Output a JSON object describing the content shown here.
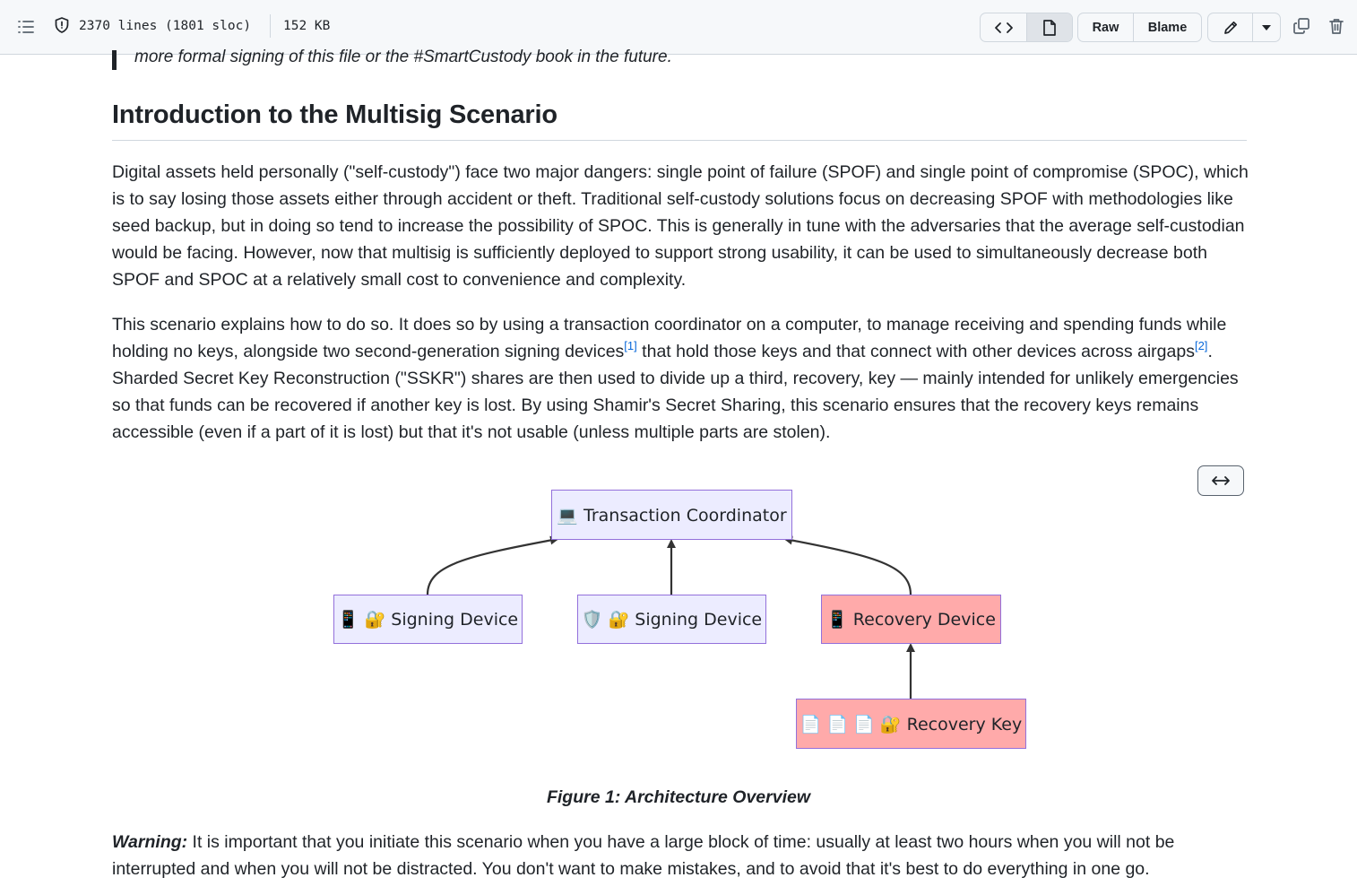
{
  "toolbar": {
    "lines_info": "2370 lines (1801 sloc)",
    "file_size": "152 KB",
    "raw_label": "Raw",
    "blame_label": "Blame"
  },
  "article": {
    "quote_text": "more formal signing of this file or the #SmartCustody book in the future.",
    "heading": "Introduction to the Multisig Scenario",
    "p1": "Digital assets held personally (\"self-custody\") face two major dangers: single point of failure (SPOF) and single point of compromise (SPOC), which is to say losing those assets either through accident or theft. Traditional self-custody solutions focus on decreasing SPOF with methodologies like seed backup, but in doing so tend to increase the possibility of SPOC. This is generally in tune with the adversaries that the average self-custodian would be facing. However, now that multisig is sufficiently deployed to support strong usability, it can be used to simultaneously decrease both SPOF and SPOC at a relatively small cost to convenience and complexity.",
    "p2_a": "This scenario explains how to do so. It does so by using a transaction coordinator on a computer, to manage receiving and spending funds while holding no keys, alongside two second-generation signing devices",
    "p2_fn1": "[1]",
    "p2_b": " that hold those keys and that connect with other devices across airgaps",
    "p2_fn2": "[2]",
    "p2_c": ". Sharded Secret Key Reconstruction (\"SSKR\") shares are then used to divide up a third, recovery, key — mainly intended for unlikely emergencies so that funds can be recovered if another key is lost. By using Shamir's Secret Sharing, this scenario ensures that the recovery keys remains accessible (even if a part of it is lost) but that it's not usable (unless multiple parts are stolen).",
    "warning_label": "Warning:",
    "warning_text": " It is important that you initiate this scenario when you have a large block of time: usually at least two hours when you will not be interrupted and when you will not be distracted. You don't want to make mistakes, and to avoid that it's best to do everything in one go."
  },
  "diagram": {
    "expand_icon": "arrows-horizontal-icon",
    "nodes": {
      "coordinator": "💻 Transaction Coordinator",
      "signing_1": "📱 🔐 Signing Device",
      "signing_2": "🛡️ 🔐 Signing Device",
      "recovery_device": "📱 Recovery Device",
      "recovery_key": "📄 📄 📄 🔐 Recovery Key"
    },
    "colors": {
      "default_fill": "#ececff",
      "recovery_fill": "#ffaaaa",
      "node_border": "#9370db",
      "edge": "#333333"
    },
    "caption": "Figure 1: Architecture Overview"
  }
}
